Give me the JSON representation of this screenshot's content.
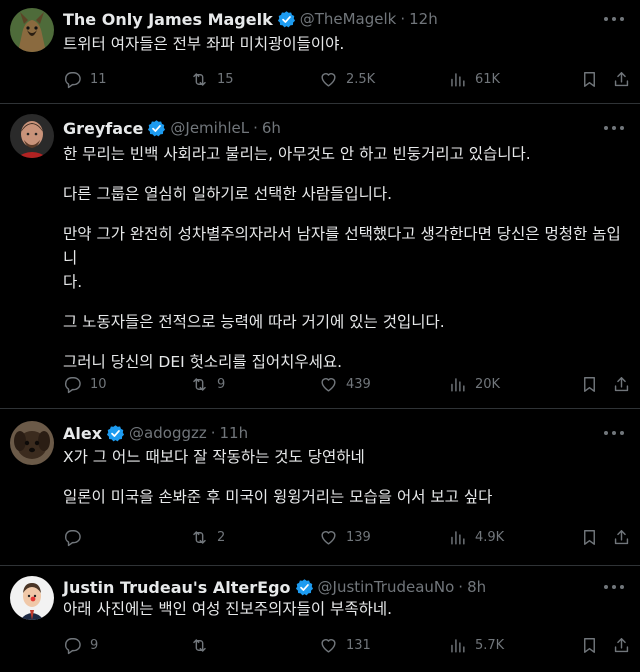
{
  "accent_color": "#1d9bf0",
  "tweets": [
    {
      "name": "The Only James Magelk",
      "handle": "@TheMagelk",
      "time": "12h",
      "verified": true,
      "lines": [
        "트위터 여자들은 전부 좌파 미치광이들이야."
      ],
      "replies": "11",
      "retweets": "15",
      "likes": "2.5K",
      "views": "61K"
    },
    {
      "name": "Greyface",
      "handle": "@JemihleL",
      "time": "6h",
      "verified": true,
      "lines": [
        "한 무리는 빈백 사회라고 불리는, 아무것도 안 하고 빈둥거리고 있습니다.",
        "",
        "다른 그룹은 열심히 일하기로 선택한 사람들입니다.",
        "",
        "만약 그가 완전히 성차별주의자라서 남자를 선택했다고 생각한다면 당신은 멍청한 놈입니",
        "다.",
        "",
        "그 노동자들은 전적으로 능력에 따라 거기에 있는 것입니다.",
        "",
        "그러니 당신의 DEI 헛소리를 집어치우세요."
      ],
      "replies": "10",
      "retweets": "9",
      "likes": "439",
      "views": "20K"
    },
    {
      "name": "Alex",
      "handle": "@adoggzz",
      "time": "11h",
      "verified": true,
      "lines": [
        "X가 그 어느 때보다 잘 작동하는 것도 당연하네",
        "",
        "일론이 미국을 손봐준 후 미국이 윙윙거리는 모습을 어서 보고 싶다"
      ],
      "replies": "",
      "retweets": "2",
      "likes": "139",
      "views": "4.9K"
    },
    {
      "name": "Justin Trudeau's AlterEgo",
      "handle": "@JustinTrudeauNo",
      "time": "8h",
      "verified": true,
      "lines": [
        "아래 사진에는 백인 여성 진보주의자들이 부족하네."
      ],
      "replies": "9",
      "retweets": "",
      "likes": "131",
      "views": "5.7K"
    }
  ]
}
